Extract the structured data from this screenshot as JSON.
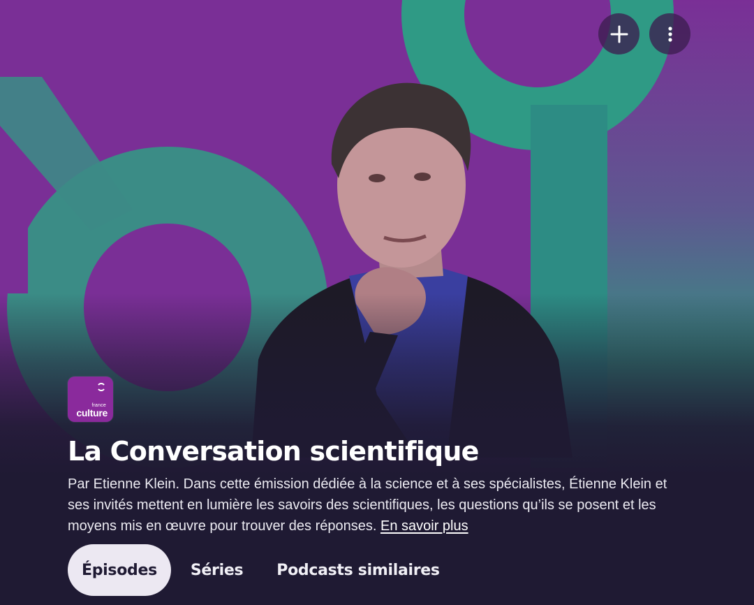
{
  "header": {
    "add_icon": "plus-icon",
    "more_icon": "more-vertical-icon"
  },
  "podcast": {
    "network_logo": {
      "small_text": "france",
      "main_text": "culture",
      "color": "#8a2a9c"
    },
    "title": "La Conversation scientifique",
    "description": "Par Etienne Klein. Dans cette émission dédiée à la science et à ses spécialistes, Étienne Klein et ses invités mettent en lumière les savoirs des scientifiques, les questions qu’ils se posent et les moyens mis en œuvre pour trouver des réponses.",
    "more_link": "En savoir plus"
  },
  "tabs": [
    {
      "label": "Épisodes",
      "active": true
    },
    {
      "label": "Séries",
      "active": false
    },
    {
      "label": "Podcasts similaires",
      "active": false
    }
  ],
  "colors": {
    "background": "#1f1a33",
    "artwork_purple": "#7a2f96",
    "artwork_teal": "#2e8f86",
    "tab_active_bg": "#ece8f2"
  }
}
